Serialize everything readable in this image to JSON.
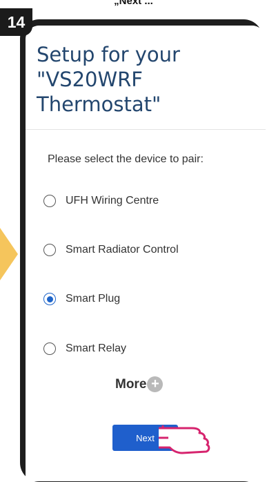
{
  "caption": "„Next ...",
  "step": "14",
  "header": {
    "title": "Setup for your\n\"VS20WRF\nThermostat\""
  },
  "prompt": "Please select the device to pair:",
  "options": [
    {
      "label": "UFH Wiring Centre",
      "selected": false
    },
    {
      "label": "Smart Radiator Control",
      "selected": false
    },
    {
      "label": "Smart Plug",
      "selected": true
    },
    {
      "label": "Smart Relay",
      "selected": false
    }
  ],
  "more_label": "More",
  "next_label": "Next",
  "colors": {
    "title": "#23466e",
    "accent": "#1d64c9",
    "button": "#1f5fcc",
    "hint_arrow": "#f5c55c",
    "hand_outline": "#d6246e"
  },
  "icons": {
    "more": "plus-icon",
    "pointer": "pointing-hand-icon",
    "hint": "arrow-right-icon"
  }
}
